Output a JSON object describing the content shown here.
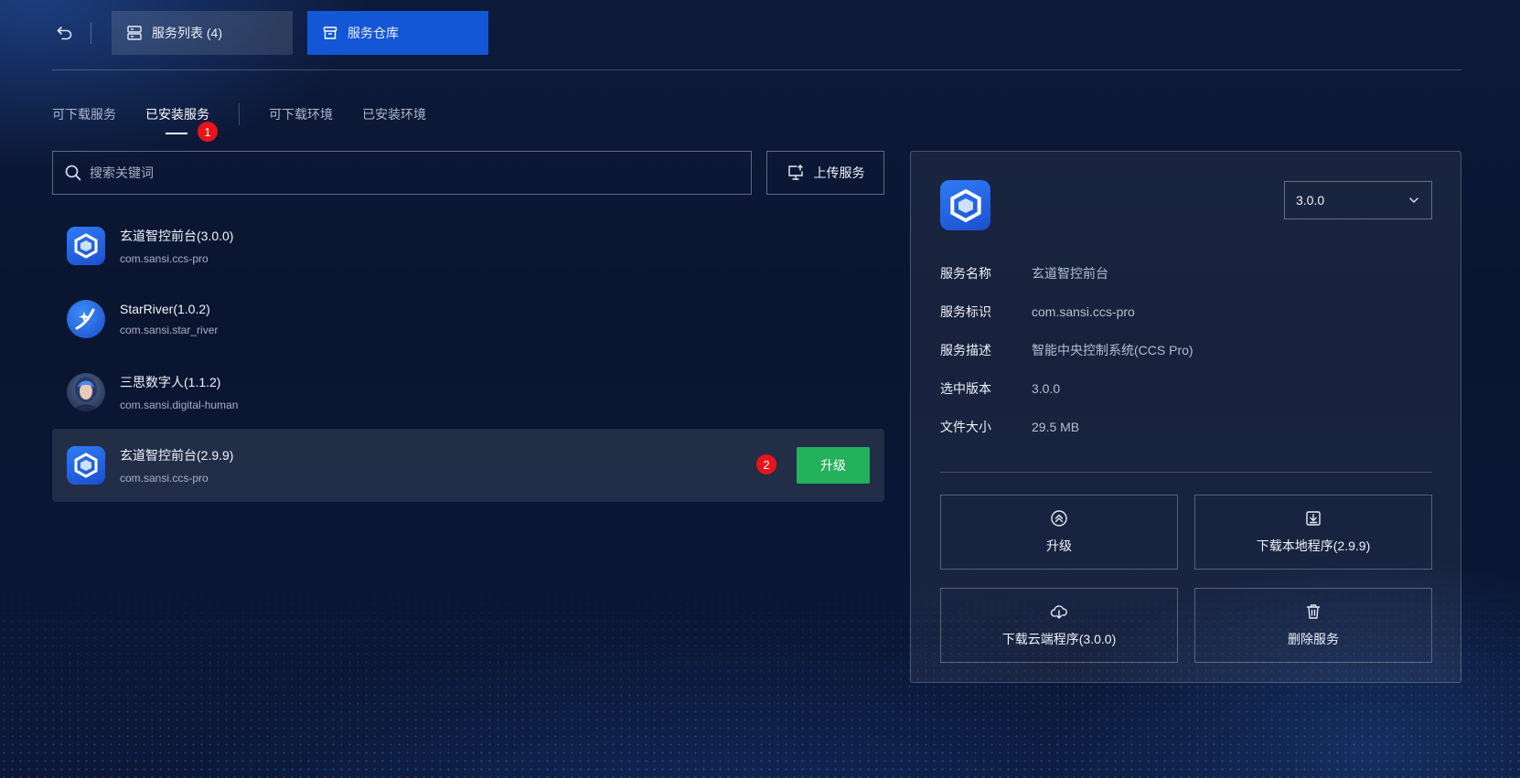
{
  "header": {
    "tabs": [
      {
        "label": "服务列表 (4)",
        "icon": "server-icon",
        "active": false
      },
      {
        "label": "服务仓库",
        "icon": "archive-icon",
        "active": true
      }
    ]
  },
  "subtabs": [
    {
      "label": "可下载服务",
      "active": false
    },
    {
      "label": "已安装服务",
      "active": true
    },
    {
      "label": "可下载环境",
      "active": false
    },
    {
      "label": "已安装环境",
      "active": false
    }
  ],
  "badges": {
    "one": "1",
    "two": "2"
  },
  "search": {
    "placeholder": "搜索关键词",
    "value": ""
  },
  "upload": {
    "label": "上传服务"
  },
  "services": [
    {
      "title": "玄道智控前台(3.0.0)",
      "id": "com.sansi.ccs-pro",
      "icon": "hexagon-app-icon"
    },
    {
      "title": "StarRiver(1.0.2)",
      "id": "com.sansi.star_river",
      "icon": "star-river-app-icon"
    },
    {
      "title": "三思数字人(1.1.2)",
      "id": "com.sansi.digital-human",
      "icon": "digital-human-avatar-icon"
    },
    {
      "title": "玄道智控前台(2.9.9)",
      "id": "com.sansi.ccs-pro",
      "icon": "hexagon-app-icon",
      "selected": true,
      "action": "升级"
    }
  ],
  "detail": {
    "version": "3.0.0",
    "fields": [
      {
        "label": "服务名称",
        "value": "玄道智控前台"
      },
      {
        "label": "服务标识",
        "value": "com.sansi.ccs-pro"
      },
      {
        "label": "服务描述",
        "value": "智能中央控制系统(CCS Pro)"
      },
      {
        "label": "选中版本",
        "value": "3.0.0"
      },
      {
        "label": "文件大小",
        "value": "29.5 MB"
      }
    ],
    "actions": [
      {
        "label": "升级",
        "icon": "upgrade-icon"
      },
      {
        "label": "下载本地程序(2.9.9)",
        "icon": "download-local-icon"
      },
      {
        "label": "下载云端程序(3.0.0)",
        "icon": "cloud-download-icon"
      },
      {
        "label": "删除服务",
        "icon": "trash-icon"
      }
    ]
  },
  "colors": {
    "accent": "#1357d6",
    "success": "#23b15c",
    "badge": "#e8141a",
    "background": "#0a1530"
  }
}
